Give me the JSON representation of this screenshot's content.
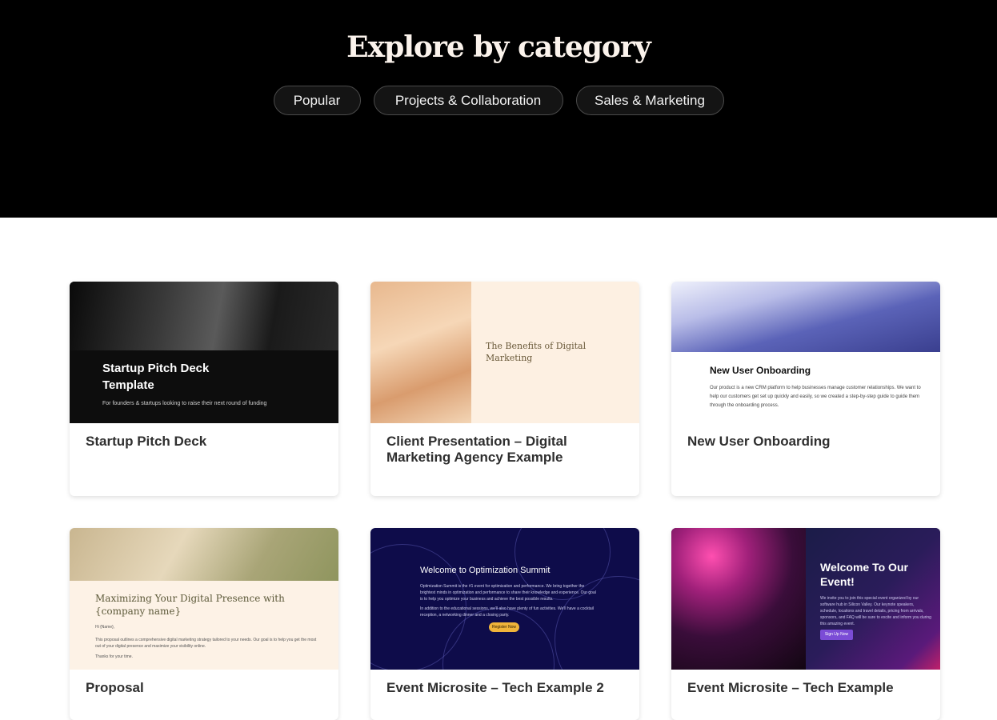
{
  "header": {
    "title": "Explore by category",
    "categories": [
      "Popular",
      "Projects & Collaboration",
      "Sales & Marketing"
    ]
  },
  "cards": [
    {
      "title": "Startup Pitch Deck",
      "thumb_heading": "Startup Pitch Deck Template",
      "thumb_subtitle": "For founders & startups looking to raise their next round of funding"
    },
    {
      "title": "Client Presentation – Digital Marketing Agency Example",
      "thumb_heading": "The Benefits of Digital Marketing"
    },
    {
      "title": "New User Onboarding",
      "thumb_heading": "New User Onboarding",
      "thumb_body": "Our product is a new CRM platform to help businesses manage customer relationships. We want to help our customers get set up quickly and easily, so we created a step-by-step guide to guide them through the onboarding process."
    },
    {
      "title": "Proposal",
      "thumb_heading": "Maximizing Your Digital Presence with {company name}",
      "thumb_greeting": "Hi {Name},",
      "thumb_body": "This proposal outlines a comprehensive digital marketing strategy tailored to your needs. Our goal is to help you get the most out of your digital presence and maximize your visibility online.",
      "thumb_closing": "Thanks for your time."
    },
    {
      "title": "Event Microsite – Tech Example 2",
      "thumb_heading": "Welcome to Optimization Summit",
      "thumb_body": "Optimization Summit is the #1 event for optimization and performance. We bring together the brightest minds in optimization and performance to share their knowledge and experience. Our goal is to help you optimize your business and achieve the best possible results.",
      "thumb_body2": "In addition to the educational sessions, we'll also have plenty of fun activities. We'll have a cocktail reception, a networking dinner and a closing party.",
      "thumb_button": "Register Now"
    },
    {
      "title": "Event Microsite – Tech Example",
      "thumb_heading": "Welcome To Our Event!",
      "thumb_body": "We invite you to join this special event organized by our software hub in Silicon Valley. Our keynote speakers, schedule, locations and travel details, pricing from arrivals, sponsors, and FAQ will be sure to excite and inform you during this amazing event.",
      "thumb_button": "Sign Up Now"
    }
  ]
}
